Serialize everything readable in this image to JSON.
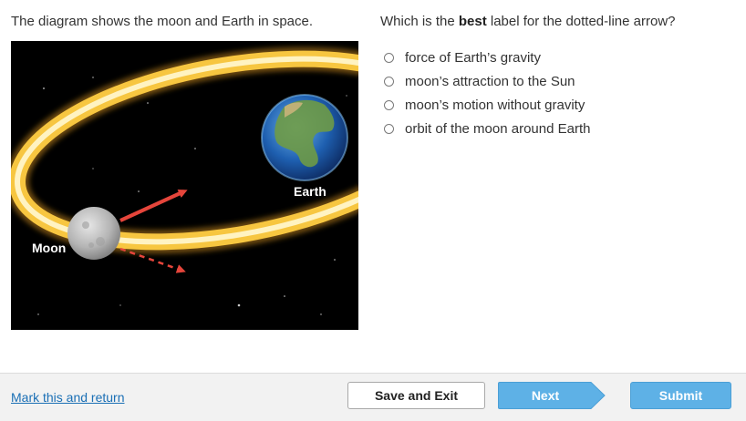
{
  "stimulus": {
    "text": "The diagram shows the moon and Earth in space.",
    "figure": {
      "earth_label": "Earth",
      "moon_label": "Moon"
    }
  },
  "question": {
    "prefix": "Which is the ",
    "emphasis": "best",
    "suffix": " label for the dotted-line arrow?"
  },
  "choices": [
    {
      "label": "force of Earth’s gravity"
    },
    {
      "label": "moon’s attraction to the Sun"
    },
    {
      "label": "moon’s motion without gravity"
    },
    {
      "label": "orbit of the moon around Earth"
    }
  ],
  "footer": {
    "mark_link": "Mark this and return",
    "save_exit": "Save and Exit",
    "next": "Next",
    "submit": "Submit"
  },
  "colors": {
    "arrow": "#e5453b",
    "orbit": "#f7c640",
    "button_blue": "#5eb1e6"
  }
}
